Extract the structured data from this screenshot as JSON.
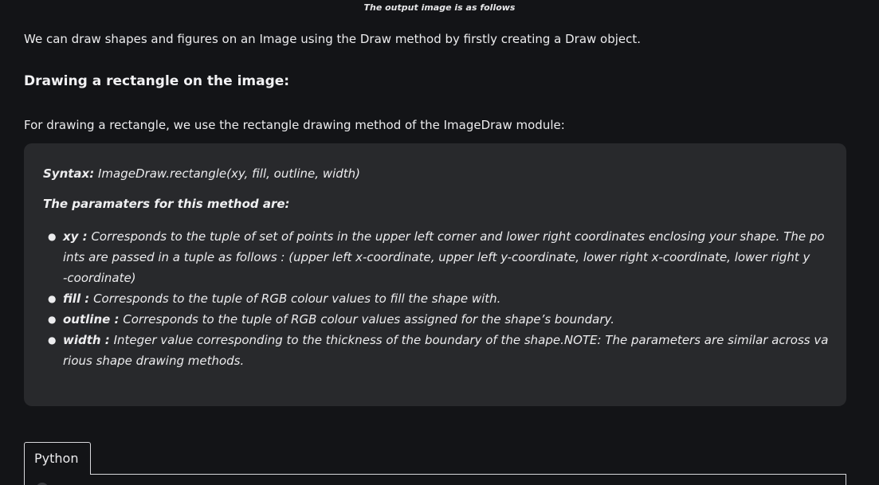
{
  "caption": "The output image is as follows",
  "intro": "We can draw shapes and figures on an Image using the Draw method by firstly creating a Draw object.",
  "section_heading": "Drawing a rectangle on the image:",
  "lead": "For drawing a rectangle, we use the rectangle drawing method of the ImageDraw module:",
  "syntax": {
    "label": "Syntax:",
    "signature": " ImageDraw.rectangle(xy, fill, outline, width)"
  },
  "params_heading": "The paramaters for this method are:",
  "params": [
    {
      "name": "xy :",
      "lines": [
        " Corresponds to the tuple of set of points in the upper left corner and lower right coordinates enclosing your shape. The po",
        "ints are passed in a tuple as follows :  (upper left x-coordinate, upper left y-coordinate, lower right x-coordinate, lower right y",
        "-coordinate)"
      ]
    },
    {
      "name": "fill :",
      "lines": [
        " Corresponds to the tuple of RGB colour values to fill the shape with."
      ]
    },
    {
      "name": "outline :",
      "lines": [
        " Corresponds to the tuple of RGB colour values assigned for the shape’s boundary."
      ]
    },
    {
      "name": "width :",
      "lines": [
        " Integer value corresponding to the thickness of the boundary of the shape.NOTE: The parameters are similar across va",
        "rious shape drawing methods."
      ]
    }
  ],
  "code_tabs": [
    {
      "label": "Python"
    }
  ],
  "colors": {
    "background": "#131417",
    "syntax_box": "#28292c",
    "text": "#ececee",
    "tab_border": "#d8d8dc"
  }
}
